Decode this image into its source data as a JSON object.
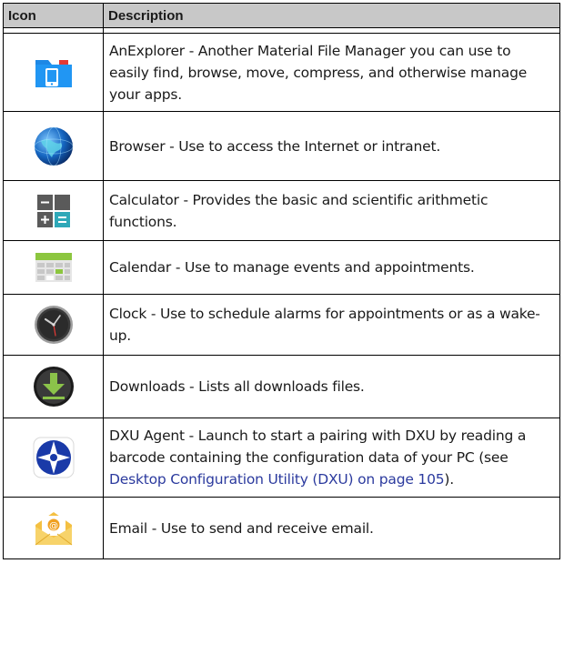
{
  "table": {
    "headers": {
      "icon": "Icon",
      "description": "Description"
    },
    "rows": [
      {
        "icon": "anexplorer-folder-icon",
        "text": "AnExplorer - Another Material File Manager you can use to easily find, browse, move, compress, and otherwise manage your apps."
      },
      {
        "icon": "globe-icon",
        "text": "Browser - Use to access the Internet or intranet."
      },
      {
        "icon": "calculator-icon",
        "text": "Calculator - Provides the basic and scientific arithmetic functions."
      },
      {
        "icon": "calendar-icon",
        "text": "Calendar - Use to manage events and appointments."
      },
      {
        "icon": "clock-icon",
        "text": "Clock - Use to schedule alarms for appointments or as a wake-up."
      },
      {
        "icon": "download-icon",
        "text": "Downloads - Lists all downloads files."
      },
      {
        "icon": "dxu-compass-icon",
        "text": "DXU Agent - Launch to start a pairing with DXU by reading a barcode containing the configuration data of your PC (see ",
        "link": "Desktop Configuration Utility (DXU) on page 105",
        "text_after": ")."
      },
      {
        "icon": "email-envelope-icon",
        "text": "Email - Use to send and receive email."
      }
    ]
  },
  "colors": {
    "header_bg": "#c8c8c8",
    "link": "#2b3a9e"
  }
}
